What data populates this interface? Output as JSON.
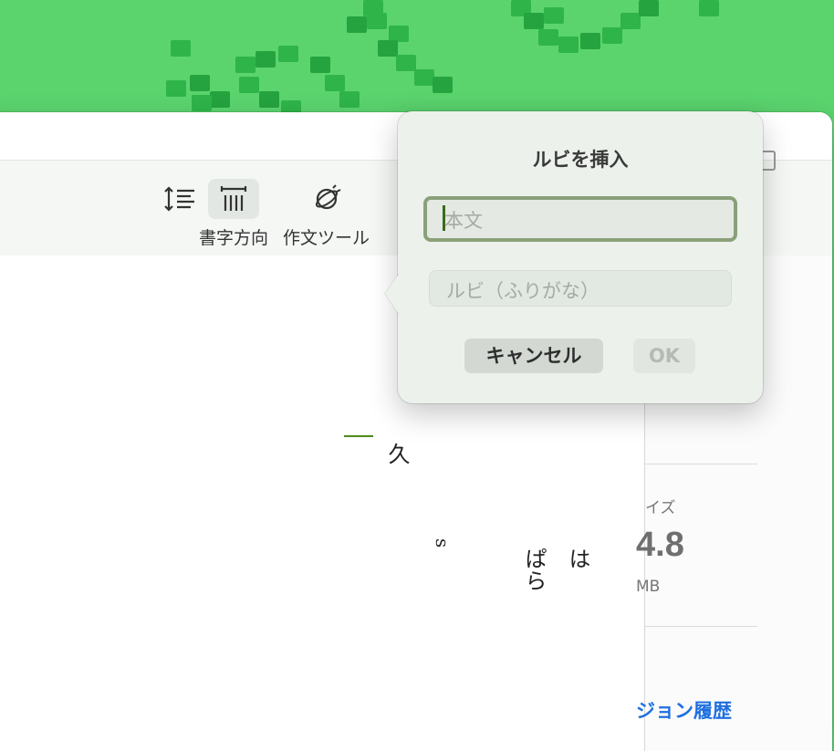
{
  "toolbar": {
    "items": [
      {
        "label": "",
        "icon": "text-spacing-icon"
      },
      {
        "label": "書字方向",
        "icon": "vertical-text-icon"
      },
      {
        "label": "作文ツール",
        "icon": "writing-tools-icon"
      }
    ]
  },
  "document": {
    "columns": [
      "は",
      "ぱら",
      "s",
      "久"
    ]
  },
  "inspector": {
    "size_label": "イズ",
    "size_value": "4.8",
    "size_unit": "MB",
    "history_link": "ジョン履歴"
  },
  "dialog": {
    "title": "ルビを挿入",
    "base_text_placeholder": "本文",
    "ruby_placeholder": "ルビ（ふりがな）",
    "cancel_label": "キャンセル",
    "ok_label": "OK"
  },
  "colors": {
    "wallpaper": "#5bd46e",
    "accent_green": "#4e8a1d",
    "link_blue": "#1f6fe0"
  }
}
